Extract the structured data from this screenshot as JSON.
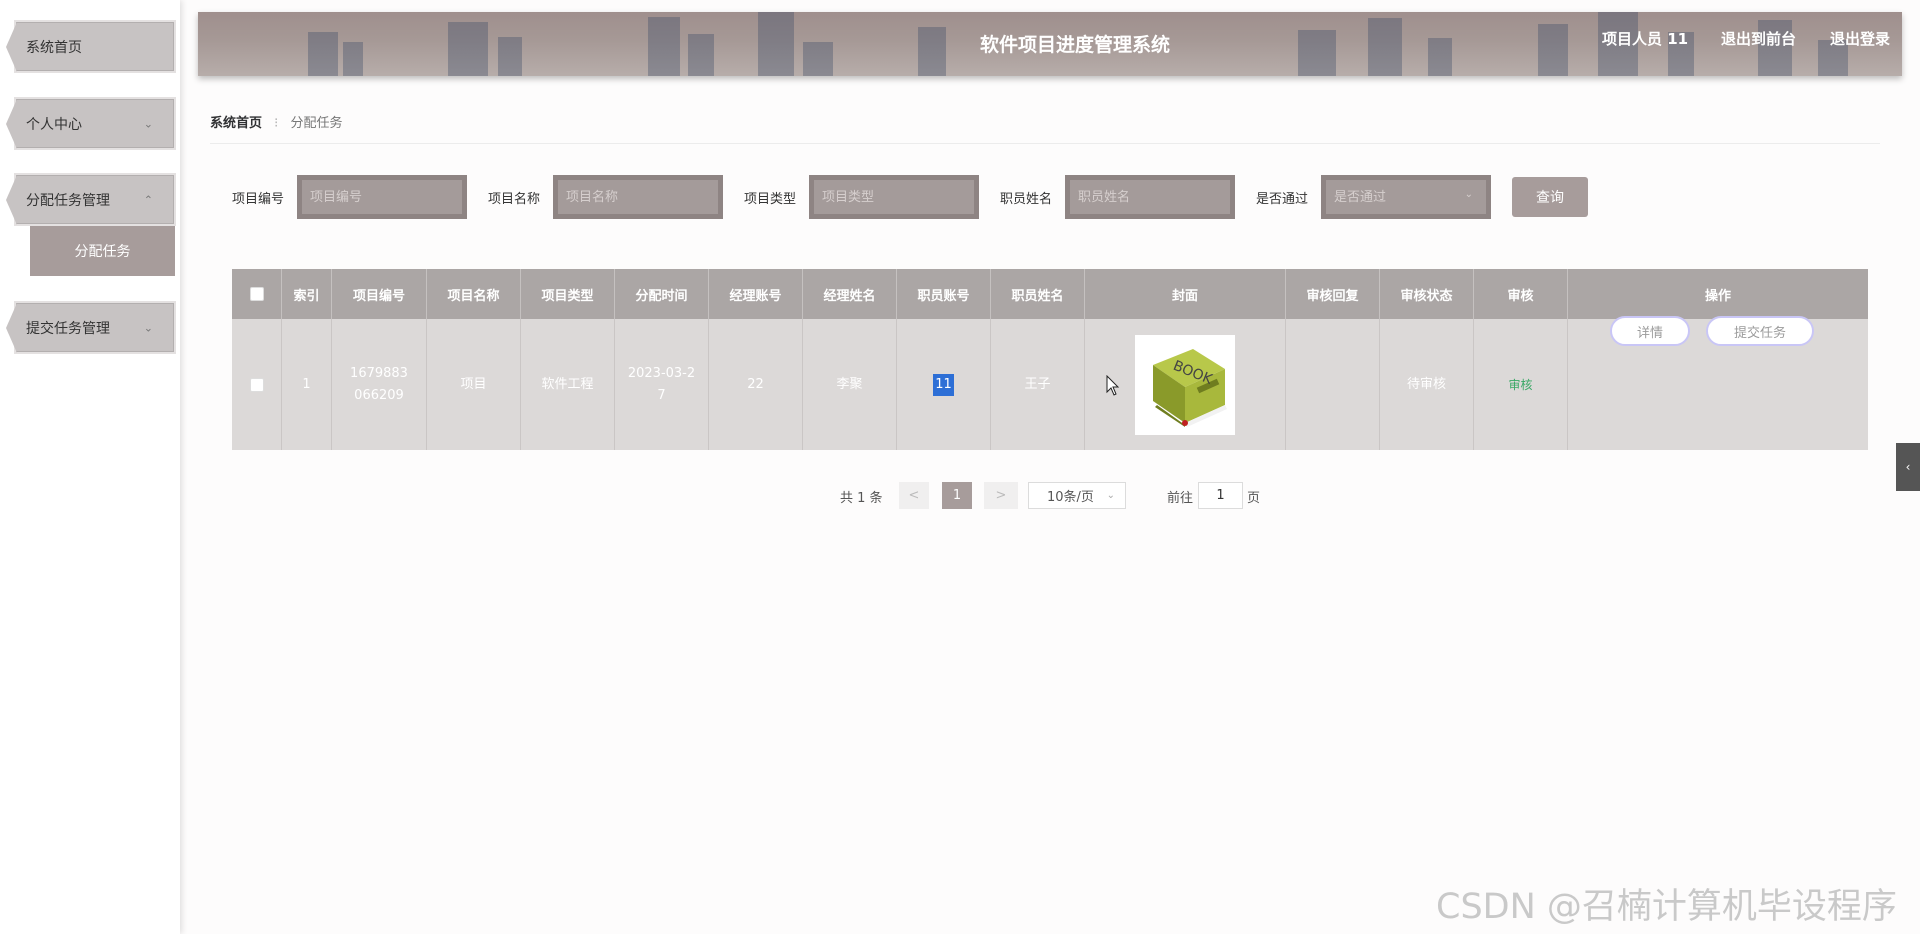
{
  "header": {
    "title": "软件项目进度管理系统",
    "user_label": "项目人员 11",
    "front_link": "退出到前台",
    "logout_link": "退出登录"
  },
  "sidebar": {
    "items": [
      {
        "label": "系统首页"
      },
      {
        "label": "个人中心"
      },
      {
        "label": "分配任务管理"
      },
      {
        "label": "提交任务管理"
      }
    ],
    "sub_item": "分配任务"
  },
  "breadcrumb": {
    "home": "系统首页",
    "separator": "⁝",
    "current": "分配任务"
  },
  "search": {
    "fields": [
      {
        "label": "项目编号",
        "placeholder": "项目编号"
      },
      {
        "label": "项目名称",
        "placeholder": "项目名称"
      },
      {
        "label": "项目类型",
        "placeholder": "项目类型"
      },
      {
        "label": "职员姓名",
        "placeholder": "职员姓名"
      },
      {
        "label": "是否通过",
        "placeholder": "是否通过"
      }
    ],
    "button": "查询"
  },
  "table": {
    "columns": [
      "索引",
      "项目编号",
      "项目名称",
      "项目类型",
      "分配时间",
      "经理账号",
      "经理姓名",
      "职员账号",
      "职员姓名",
      "封面",
      "审核回复",
      "审核状态",
      "审核",
      "操作"
    ],
    "rows": [
      {
        "index": "1",
        "project_no": "1679883066209",
        "project_name": "项目",
        "project_type": "软件工程",
        "assign_time": "2023-03-27",
        "manager_account": "22",
        "manager_name": "李聚",
        "staff_account": "11",
        "staff_name": "王子",
        "cover_text": "BOOK",
        "review_reply": "",
        "review_status": "待审核",
        "review_action": "审核",
        "detail_button": "详情",
        "submit_button": "提交任务"
      }
    ]
  },
  "pagination": {
    "total": "共 1 条",
    "prev": "<",
    "current_page": "1",
    "next": ">",
    "page_size": "10条/页",
    "goto_label": "前往",
    "goto_value": "1",
    "page_suffix": "页"
  },
  "watermark": "CSDN @召楠计算机毕设程序",
  "colors": {
    "accent": "#a79c9b",
    "header": "#a69996",
    "status_green": "#3aa866"
  }
}
